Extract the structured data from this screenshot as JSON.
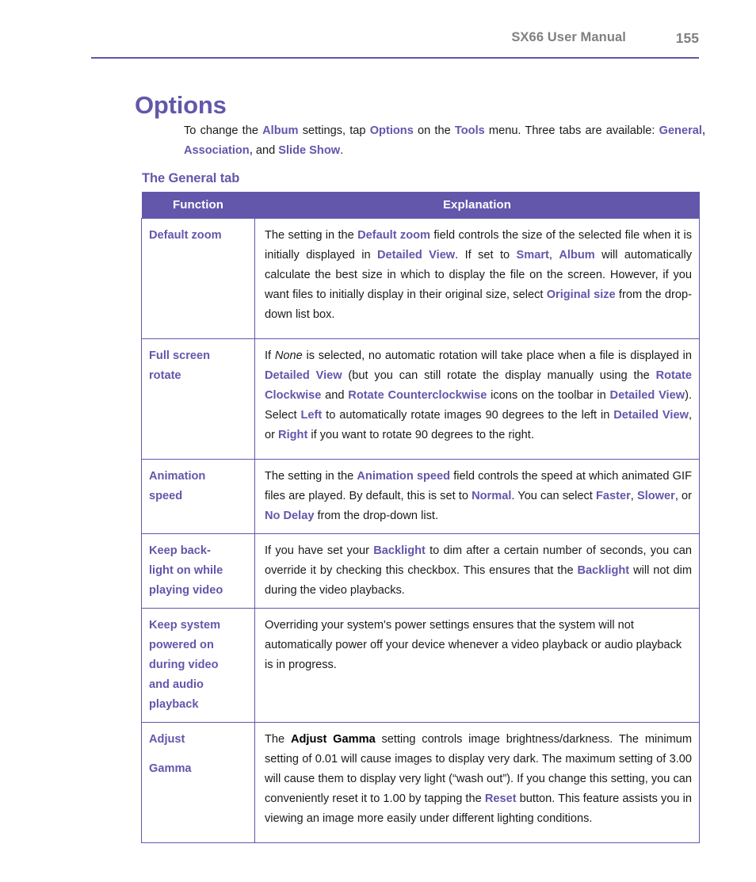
{
  "header": {
    "manual_title": "SX66 User Manual",
    "page_number": "155",
    "rule_color": "#5f56a8"
  },
  "title": "Options",
  "intro": {
    "line1_part1": "To change the ",
    "kw_album": "Album",
    "line1_part2": " settings, tap ",
    "kw_options": "Options",
    "line1_part3": " on the ",
    "kw_tools": "Tools",
    "line1_part4": " menu. Three tabs are available: ",
    "kw_general": "General,",
    "kw_association": "Association,",
    "line1_part5": " and ",
    "kw_slideshow": "Slide Show",
    "line1_part6": "."
  },
  "sub_heading": "The General tab",
  "table": {
    "headers": {
      "function": "Function",
      "explanation": "Explanation"
    },
    "accent_color": "#6257ab",
    "rows": [
      {
        "function": "Default zoom",
        "explanation_plain": "The setting in the Default zoom field controls the size of the selected file when it is initially displayed in Detailed View. If set to Smart, Album will automatically calculate the best size in which to display the file on the screen. However, if you want files to initially display in their original size, select Original size from the drop-down list box.",
        "parts": [
          {
            "t": "The setting in the ",
            "s": "plain"
          },
          {
            "t": "Default zoom",
            "s": "kw"
          },
          {
            "t": " field controls the size of the selected file when it is initially displayed in ",
            "s": "plain"
          },
          {
            "t": "Detailed View",
            "s": "kw"
          },
          {
            "t": ". If set to ",
            "s": "plain"
          },
          {
            "t": "Smart",
            "s": "kw"
          },
          {
            "t": ", ",
            "s": "plain"
          },
          {
            "t": "Album",
            "s": "kw"
          },
          {
            "t": " will automatically calculate the best size in which to display the file on the screen. However, if you want files to initially display in their original size, select ",
            "s": "plain"
          },
          {
            "t": "Original size",
            "s": "kw"
          },
          {
            "t": " from the drop-down list box.",
            "s": "plain"
          }
        ]
      },
      {
        "function": "Full screen rotate",
        "explanation_plain": "If None is selected, no automatic rotation will take place when a file is displayed in Detailed View (but you can still rotate the display manually using the Rotate Clockwise and Rotate Counterclockwise icons on the toolbar in Detailed View). Select Left to automatically rotate images 90 degrees to the left in Detailed View, or Right if you want to rotate 90 degrees to the right.",
        "parts": [
          {
            "t": "If ",
            "s": "plain"
          },
          {
            "t": "None",
            "s": "it"
          },
          {
            "t": " is selected, no automatic rotation will take place when a file is displayed in ",
            "s": "plain"
          },
          {
            "t": "Detailed View",
            "s": "kw"
          },
          {
            "t": " (but you can still rotate the display manually using the ",
            "s": "plain"
          },
          {
            "t": "Rotate Clockwise",
            "s": "kw"
          },
          {
            "t": " and ",
            "s": "plain"
          },
          {
            "t": "Rotate Counterclockwise",
            "s": "kw"
          },
          {
            "t": " icons on the toolbar in ",
            "s": "plain"
          },
          {
            "t": "Detailed View",
            "s": "kw"
          },
          {
            "t": "). Select ",
            "s": "plain"
          },
          {
            "t": "Left",
            "s": "kw"
          },
          {
            "t": " to automatically rotate images 90 degrees to the left in ",
            "s": "plain"
          },
          {
            "t": "Detailed View",
            "s": "kw"
          },
          {
            "t": ", or ",
            "s": "plain"
          },
          {
            "t": "Right",
            "s": "kw"
          },
          {
            "t": " if you want to rotate 90 degrees to the right.",
            "s": "plain"
          }
        ]
      },
      {
        "function": "Animation speed",
        "explanation_plain": "The setting in the Animation speed field controls the speed at which animated GIF files are played. By default, this is set to Normal. You can select Faster, Slower, or No Delay from the drop-down list.",
        "parts": [
          {
            "t": "The setting in the ",
            "s": "plain"
          },
          {
            "t": "Animation speed",
            "s": "kw"
          },
          {
            "t": " field controls the speed at which animated GIF files are played. By default, this is set to ",
            "s": "plain"
          },
          {
            "t": "Normal",
            "s": "kw"
          },
          {
            "t": ". You can select ",
            "s": "plain"
          },
          {
            "t": "Faster",
            "s": "kw"
          },
          {
            "t": ", ",
            "s": "plain"
          },
          {
            "t": "Slower",
            "s": "kw"
          },
          {
            "t": ", or ",
            "s": "plain"
          },
          {
            "t": "No Delay",
            "s": "kw"
          },
          {
            "t": " from the drop-down list.",
            "s": "plain"
          }
        ]
      },
      {
        "function": "Keep back-light on while playing video",
        "explanation_plain": "If you have set your Backlight to dim after a certain number of seconds, you can override it by checking this checkbox. This ensures that the Backlight will not dim during the video playbacks.",
        "parts": [
          {
            "t": "If you have set your ",
            "s": "plain"
          },
          {
            "t": "Backlight",
            "s": "kw"
          },
          {
            "t": " to dim after a certain number of seconds, you can override it by checking this checkbox. This ensures that the ",
            "s": "plain"
          },
          {
            "t": "Backlight",
            "s": "kw"
          },
          {
            "t": " will not dim during the video playbacks.",
            "s": "plain"
          }
        ]
      },
      {
        "function": "Keep system powered on during video and audio playback",
        "explanation_plain": "Overriding your system's power settings ensures that the system will not automatically power off your device whenever a video playback or audio playback is in progress.",
        "parts": [
          {
            "t": "Overriding your system's power settings ensures that the system will not automatically power off your device whenever a video playback or audio playback is in progress.",
            "s": "plain"
          }
        ]
      },
      {
        "function": "Adjust\n\nGamma",
        "explanation_plain": "The Adjust Gamma setting controls image brightness/darkness. The minimum setting of 0.01 will cause images to display very dark. The maximum setting of 3.00 will cause them to display very light (“wash out”). If you change this setting, you can conveniently reset it to 1.00 by tapping the Reset button. This feature assists you in viewing an image more easily under different lighting conditions.",
        "parts": [
          {
            "t": "The ",
            "s": "plain"
          },
          {
            "t": "Adjust Gamma",
            "s": "bk"
          },
          {
            "t": " setting controls image brightness/darkness. The minimum setting of 0.01 will cause images to display very dark. The maximum setting of 3.00 will cause them to display very light (“wash out”). If you change this setting, you can conveniently reset it to 1.00 by tapping the ",
            "s": "plain"
          },
          {
            "t": "Reset",
            "s": "kw"
          },
          {
            "t": " button. This feature assists you in viewing an image more easily under different lighting conditions.",
            "s": "plain"
          }
        ]
      }
    ],
    "row_function_lines": [
      [
        "Default zoom"
      ],
      [
        "Full screen",
        "rotate"
      ],
      [
        "Animation",
        "speed"
      ],
      [
        "Keep back-",
        "light on while",
        "playing video"
      ],
      [
        "Keep system",
        "powered on",
        "during video",
        "and audio",
        "playback"
      ],
      [
        "Adjust",
        "Gamma"
      ]
    ]
  }
}
